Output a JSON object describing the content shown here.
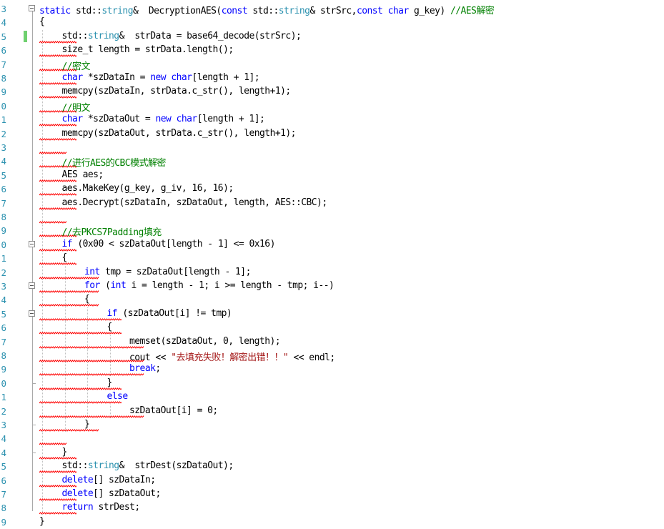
{
  "editor": {
    "lines": [
      {
        "n": "3",
        "indent": 0,
        "squig": 0,
        "fold": true,
        "tokens": [
          {
            "t": "static ",
            "c": "kw"
          },
          {
            "t": "std::"
          },
          {
            "t": "string",
            "c": "type"
          },
          {
            "t": "&  DecryptionAES("
          },
          {
            "t": "const ",
            "c": "kw"
          },
          {
            "t": "std::"
          },
          {
            "t": "string",
            "c": "type"
          },
          {
            "t": "& strSrc,"
          },
          {
            "t": "const char ",
            "c": "kw"
          },
          {
            "t": "g_key) "
          },
          {
            "t": "//AES解密",
            "c": "cm"
          }
        ]
      },
      {
        "n": "4",
        "indent": 0,
        "squig": 0,
        "tokens": [
          {
            "t": "{"
          }
        ]
      },
      {
        "n": "5",
        "indent": 1,
        "squig": 1,
        "change": true,
        "tokens": [
          {
            "t": "std::"
          },
          {
            "t": "string",
            "c": "type"
          },
          {
            "t": "&  strData = base64_decode(strSrc);"
          }
        ]
      },
      {
        "n": "6",
        "indent": 1,
        "squig": 1,
        "tokens": [
          {
            "t": "size_t length = strData.length();"
          }
        ]
      },
      {
        "n": "7",
        "indent": 1,
        "squig": 1,
        "tokens": [
          {
            "t": "//密文",
            "c": "cm"
          }
        ]
      },
      {
        "n": "8",
        "indent": 1,
        "squig": 1,
        "tokens": [
          {
            "t": "char ",
            "c": "kw"
          },
          {
            "t": "*szDataIn = "
          },
          {
            "t": "new char",
            "c": "kw"
          },
          {
            "t": "[length + 1];"
          }
        ]
      },
      {
        "n": "9",
        "indent": 1,
        "squig": 1,
        "tokens": [
          {
            "t": "memcpy(szDataIn, strData.c_str(), length+1);"
          }
        ]
      },
      {
        "n": "0",
        "indent": 1,
        "squig": 1,
        "tokens": [
          {
            "t": "//明文",
            "c": "cm"
          }
        ]
      },
      {
        "n": "1",
        "indent": 1,
        "squig": 1,
        "tokens": [
          {
            "t": "char ",
            "c": "kw"
          },
          {
            "t": "*szDataOut = "
          },
          {
            "t": "new char",
            "c": "kw"
          },
          {
            "t": "[length + 1];"
          }
        ]
      },
      {
        "n": "2",
        "indent": 1,
        "squig": 1,
        "tokens": [
          {
            "t": "memcpy(szDataOut, strData.c_str(), length+1);"
          }
        ]
      },
      {
        "n": "3",
        "indent": 1,
        "squig": 1,
        "tokens": []
      },
      {
        "n": "4",
        "indent": 1,
        "squig": 1,
        "tokens": [
          {
            "t": "//进行AES的CBC模式解密",
            "c": "cm"
          }
        ]
      },
      {
        "n": "5",
        "indent": 1,
        "squig": 1,
        "tokens": [
          {
            "t": "AES aes;"
          }
        ]
      },
      {
        "n": "6",
        "indent": 1,
        "squig": 1,
        "tokens": [
          {
            "t": "aes.MakeKey(g_key, g_iv, 16, 16);"
          }
        ]
      },
      {
        "n": "7",
        "indent": 1,
        "squig": 1,
        "tokens": [
          {
            "t": "aes.Decrypt(szDataIn, szDataOut, length, AES::CBC);"
          }
        ]
      },
      {
        "n": "8",
        "indent": 1,
        "squig": 1,
        "tokens": []
      },
      {
        "n": "9",
        "indent": 1,
        "squig": 1,
        "tokens": [
          {
            "t": "//去PKCS7Padding填充",
            "c": "cm"
          }
        ]
      },
      {
        "n": "0",
        "indent": 1,
        "squig": 1,
        "fold": true,
        "tokens": [
          {
            "t": "if ",
            "c": "kw"
          },
          {
            "t": "(0x00 < szDataOut[length - 1] <= 0x16)"
          }
        ]
      },
      {
        "n": "1",
        "indent": 1,
        "squig": 1,
        "tokens": [
          {
            "t": "{"
          }
        ]
      },
      {
        "n": "2",
        "indent": 2,
        "squig": 2,
        "tokens": [
          {
            "t": "int ",
            "c": "kw"
          },
          {
            "t": "tmp = szDataOut[length - 1];"
          }
        ]
      },
      {
        "n": "3",
        "indent": 2,
        "squig": 2,
        "fold": true,
        "tokens": [
          {
            "t": "for ",
            "c": "kw"
          },
          {
            "t": "("
          },
          {
            "t": "int ",
            "c": "kw"
          },
          {
            "t": "i = length - 1; i >= length - tmp; i--)"
          }
        ]
      },
      {
        "n": "4",
        "indent": 2,
        "squig": 2,
        "tokens": [
          {
            "t": "{"
          }
        ]
      },
      {
        "n": "5",
        "indent": 3,
        "squig": 3,
        "fold": true,
        "tokens": [
          {
            "t": "if ",
            "c": "kw"
          },
          {
            "t": "(szDataOut[i] != tmp)"
          }
        ]
      },
      {
        "n": "6",
        "indent": 3,
        "squig": 3,
        "tokens": [
          {
            "t": "{"
          }
        ]
      },
      {
        "n": "7",
        "indent": 4,
        "squig": 4,
        "tokens": [
          {
            "t": "memset(szDataOut, 0, length);"
          }
        ]
      },
      {
        "n": "8",
        "indent": 4,
        "squig": 4,
        "tokens": [
          {
            "t": "cout << "
          },
          {
            "t": "\"去填充失败！解密出错！！\"",
            "c": "str"
          },
          {
            "t": " << endl;"
          }
        ]
      },
      {
        "n": "9",
        "indent": 4,
        "squig": 4,
        "tokens": [
          {
            "t": "break",
            "c": "kw"
          },
          {
            "t": ";"
          }
        ]
      },
      {
        "n": "0",
        "indent": 3,
        "squig": 3,
        "tokens": [
          {
            "t": "}"
          }
        ]
      },
      {
        "n": "1",
        "indent": 3,
        "squig": 3,
        "tokens": [
          {
            "t": "else",
            "c": "kw"
          }
        ]
      },
      {
        "n": "2",
        "indent": 4,
        "squig": 4,
        "tokens": [
          {
            "t": "szDataOut[i] = 0;"
          }
        ]
      },
      {
        "n": "3",
        "indent": 2,
        "squig": 2,
        "tokens": [
          {
            "t": "}"
          }
        ]
      },
      {
        "n": "4",
        "indent": 1,
        "squig": 1,
        "tokens": []
      },
      {
        "n": "4b",
        "indent": 1,
        "squig": 1,
        "tokens": [
          {
            "t": "}"
          }
        ]
      },
      {
        "n": "5",
        "indent": 1,
        "squig": 1,
        "tokens": [
          {
            "t": "std::"
          },
          {
            "t": "string",
            "c": "type"
          },
          {
            "t": "&  strDest(szDataOut);"
          }
        ]
      },
      {
        "n": "6",
        "indent": 1,
        "squig": 1,
        "tokens": [
          {
            "t": "delete",
            "c": "kw"
          },
          {
            "t": "[] szDataIn;"
          }
        ]
      },
      {
        "n": "7",
        "indent": 1,
        "squig": 1,
        "tokens": [
          {
            "t": "delete",
            "c": "kw"
          },
          {
            "t": "[] szDataOut;"
          }
        ]
      },
      {
        "n": "8",
        "indent": 1,
        "squig": 1,
        "tokens": [
          {
            "t": "return ",
            "c": "kw"
          },
          {
            "t": "strDest;"
          }
        ]
      },
      {
        "n": "9",
        "indent": 0,
        "squig": 0,
        "tokens": [
          {
            "t": "}"
          }
        ]
      }
    ]
  }
}
